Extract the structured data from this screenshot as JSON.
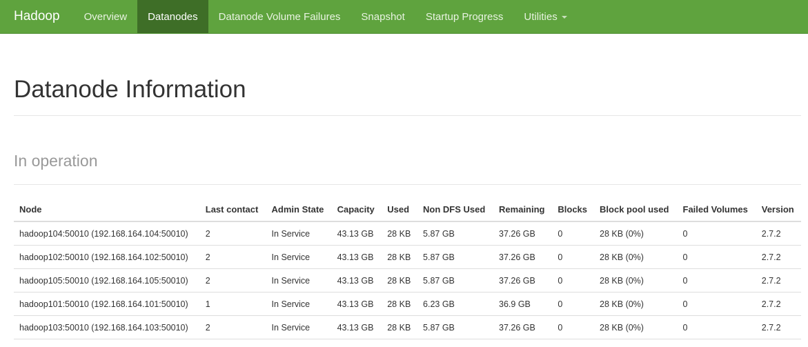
{
  "navbar": {
    "brand": "Hadoop",
    "items": [
      {
        "label": "Overview"
      },
      {
        "label": "Datanodes"
      },
      {
        "label": "Datanode Volume Failures"
      },
      {
        "label": "Snapshot"
      },
      {
        "label": "Startup Progress"
      },
      {
        "label": "Utilities"
      }
    ],
    "active_item": "Datanodes",
    "colors": {
      "background": "#5fa33e",
      "active": "#3e6e27"
    }
  },
  "page": {
    "title": "Datanode Information",
    "section_title": "In operation"
  },
  "table": {
    "headers": [
      "Node",
      "Last contact",
      "Admin State",
      "Capacity",
      "Used",
      "Non DFS Used",
      "Remaining",
      "Blocks",
      "Block pool used",
      "Failed Volumes",
      "Version"
    ],
    "rows": [
      [
        "hadoop104:50010 (192.168.164.104:50010)",
        "2",
        "In Service",
        "43.13 GB",
        "28 KB",
        "5.87 GB",
        "37.26 GB",
        "0",
        "28 KB (0%)",
        "0",
        "2.7.2"
      ],
      [
        "hadoop102:50010 (192.168.164.102:50010)",
        "2",
        "In Service",
        "43.13 GB",
        "28 KB",
        "5.87 GB",
        "37.26 GB",
        "0",
        "28 KB (0%)",
        "0",
        "2.7.2"
      ],
      [
        "hadoop105:50010 (192.168.164.105:50010)",
        "2",
        "In Service",
        "43.13 GB",
        "28 KB",
        "5.87 GB",
        "37.26 GB",
        "0",
        "28 KB (0%)",
        "0",
        "2.7.2"
      ],
      [
        "hadoop101:50010 (192.168.164.101:50010)",
        "1",
        "In Service",
        "43.13 GB",
        "28 KB",
        "6.23 GB",
        "36.9 GB",
        "0",
        "28 KB (0%)",
        "0",
        "2.7.2"
      ],
      [
        "hadoop103:50010 (192.168.164.103:50010)",
        "2",
        "In Service",
        "43.13 GB",
        "28 KB",
        "5.87 GB",
        "37.26 GB",
        "0",
        "28 KB (0%)",
        "0",
        "2.7.2"
      ]
    ]
  }
}
